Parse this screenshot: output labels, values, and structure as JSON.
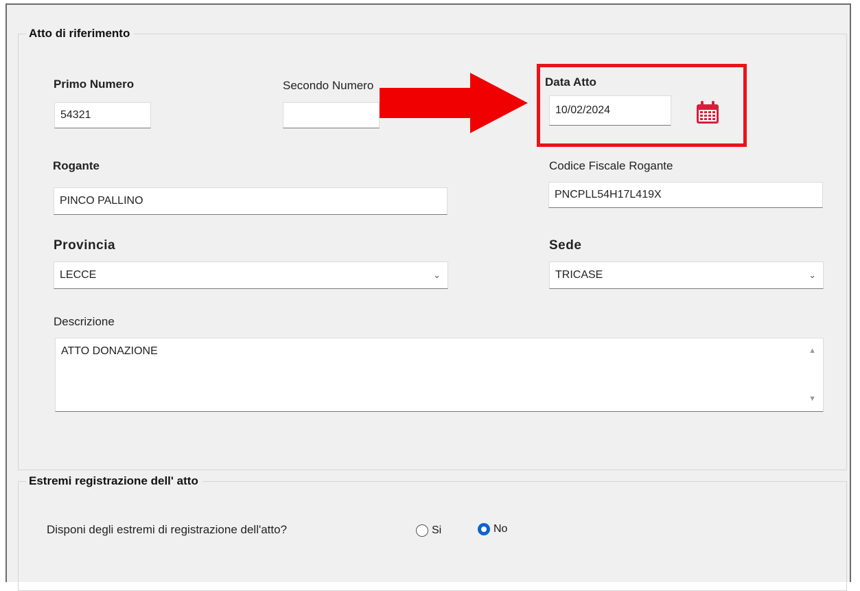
{
  "section1": {
    "title": "Atto di riferimento",
    "primo_numero": {
      "label": "Primo Numero",
      "value": "54321"
    },
    "secondo_numero": {
      "label": "Secondo Numero",
      "value": ""
    },
    "data_atto": {
      "label": "Data Atto",
      "value": "10/02/2024",
      "icon": "calendar-icon"
    },
    "rogante": {
      "label": "Rogante",
      "value": "PINCO PALLINO"
    },
    "codice_fiscale": {
      "label": "Codice Fiscale Rogante",
      "value": "PNCPLL54H17L419X"
    },
    "provincia": {
      "label": "Provincia",
      "value": "LECCE"
    },
    "sede": {
      "label": "Sede",
      "value": "TRICASE"
    },
    "descrizione": {
      "label": "Descrizione",
      "value": "ATTO DONAZIONE"
    }
  },
  "section2": {
    "title": "Estremi registrazione dell' atto",
    "question": "Disponi degli estremi di registrazione dell'atto?",
    "options": [
      {
        "label": "Si",
        "selected": false
      },
      {
        "label": "No",
        "selected": true
      }
    ]
  },
  "annotation": {
    "highlight_color": "#e8141a",
    "arrow_color": "#f00000"
  },
  "colors": {
    "radio_accent": "#0a64d0",
    "calendar_icon": "#d81e3a"
  }
}
